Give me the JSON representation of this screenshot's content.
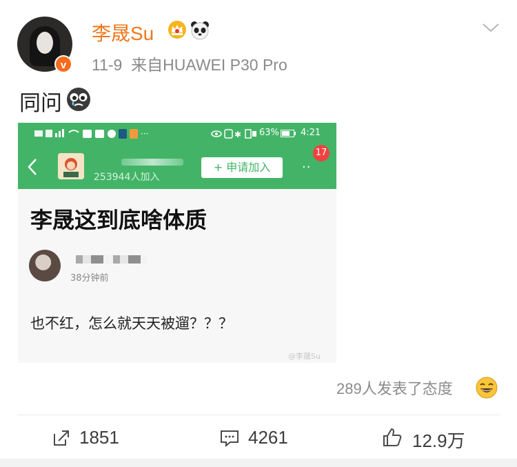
{
  "header": {
    "username": "李晟Su",
    "date": "11-9",
    "source_prefix": "来自",
    "source_device": "HUAWEI P30 Pro",
    "verified_badge": "v"
  },
  "post": {
    "text": "同问"
  },
  "embedded_screenshot": {
    "status_bar": {
      "battery": "63%",
      "time": "4:21"
    },
    "group": {
      "member_count": "253944人加入",
      "join_label": "+ 申请加入",
      "notification_count": "17",
      "more": "··"
    },
    "title": "李晟这到底啥体质",
    "post_time": "38分钟前",
    "body": "也不红，怎么就天天被遛？？？",
    "watermark": "@李晟Su"
  },
  "reactions": {
    "text": "289人发表了态度"
  },
  "actions": {
    "repost_count": "1851",
    "comment_count": "4261",
    "like_count": "12.9万"
  },
  "colors": {
    "username": "#f0771b",
    "group_green": "#43b467",
    "badge_red": "#f04140",
    "verified_orange": "#f76b1c"
  },
  "icons": [
    "crown-icon",
    "panda-icon",
    "chevron-down-icon",
    "sad-emoji-icon",
    "back-icon",
    "laugh-emoji-icon",
    "repost-icon",
    "comment-icon",
    "like-icon"
  ]
}
